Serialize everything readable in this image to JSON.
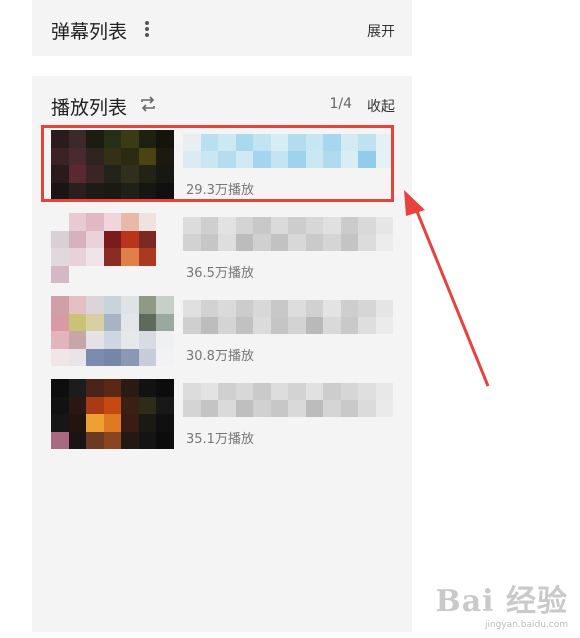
{
  "danmaku": {
    "title": "弹幕列表",
    "expand_label": "展开"
  },
  "playlist": {
    "title": "播放列表",
    "counter": "1/4",
    "collapse_label": "收起",
    "items": [
      {
        "plays": "29.3万播放",
        "selected": true
      },
      {
        "plays": "36.5万播放",
        "selected": false
      },
      {
        "plays": "30.8万播放",
        "selected": false
      },
      {
        "plays": "35.1万播放",
        "selected": false
      }
    ]
  },
  "annotation": {
    "highlight_color": "#e8423c",
    "arrow_color": "#e8423c"
  },
  "watermark": {
    "logo": "Bai 经验",
    "url": "jingyan.baidu.com"
  },
  "icons": {
    "menu": "more-vertical-icon",
    "loop": "loop-icon"
  }
}
